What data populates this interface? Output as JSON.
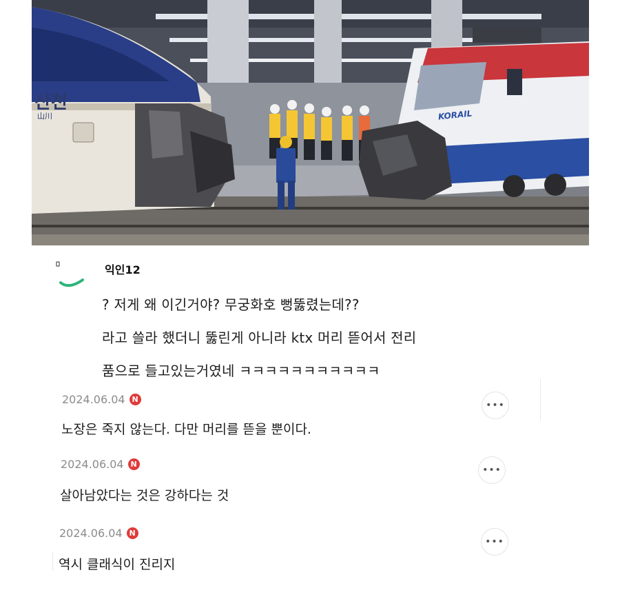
{
  "photo": {
    "alt": "",
    "train_label": "산천",
    "train_sublabel": "山川",
    "loco_logo": "KORAIL"
  },
  "post": {
    "avatar_icon": "avatar-placeholder-icon",
    "username": "익인12",
    "lines": [
      "? 저게 왜 이긴거야? 무궁화호 뻥뚫렸는데??",
      "라고 쓸라 했더니 뚫린게 아니라 ktx 머리 뜯어서 전리",
      "품으로 들고있는거였네 ㅋㅋㅋㅋㅋㅋㅋㅋㅋㅋㅋ"
    ]
  },
  "comments": [
    {
      "date": "2024.06.04",
      "badge": "N",
      "text": "노장은 죽지 않는다. 다만 머리를 뜯을 뿐이다."
    },
    {
      "date": "2024.06.04",
      "badge": "N",
      "text": "살아남았다는 것은 강하다는 것"
    },
    {
      "date": "2024.06.04",
      "badge": "N",
      "text": "역시 클래식이 진리지"
    }
  ],
  "more_label": "•••",
  "colors": {
    "accent_green": "#2db57a",
    "badge_red": "#e03a3a",
    "date_gray": "#8b8b8b"
  }
}
